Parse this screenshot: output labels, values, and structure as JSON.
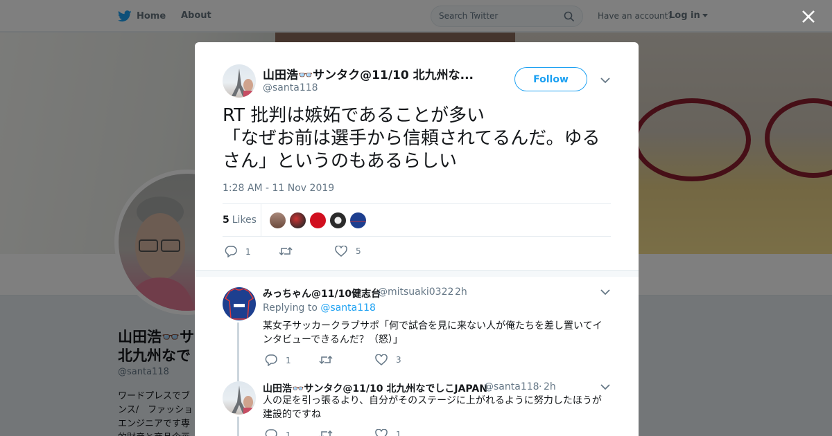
{
  "header": {
    "home_label": "Home",
    "about_label": "About",
    "search_placeholder": "Search Twitter",
    "have_account": "Have an account?",
    "login_label": "Log in"
  },
  "profile_bg": {
    "name": "山田浩👓サ\n北九州なで",
    "handle": "@santa118",
    "bio": "ワードプレスでブ\nンス/　ファッショ\nエンジニアです専\n的財産と商品企画"
  },
  "tweet": {
    "author_name": "山田浩👓サンタク@11/10 北九州な...",
    "author_handle": "@santa118",
    "follow_label": "Follow",
    "text": "RT 批判は嫉妬であることが多い\n「なぜお前は選手から信頼されてるんだ。ゆるさん」というのもあるらしい",
    "timestamp": "1:28 AM - 11 Nov 2019",
    "likes_count": "5",
    "likes_label": "Likes",
    "reply_count": "1",
    "retweet_count": "",
    "like_count": "5",
    "liker_colors": [
      "#7a5a4a",
      "#3d2a2a",
      "#d10f1f",
      "#2a2a2a",
      "#1d3f8f"
    ]
  },
  "replies": [
    {
      "name": "みっちゃん@11/10健志台",
      "handle": "@mitsuaki0322",
      "time": "2h",
      "replying_to_label": "Replying to",
      "replying_to_handle": "@santa118",
      "text": "某女子サッカークラブサポ「何で試合を見に来ない人が俺たちを差し置いてインタビューできるんだ？（怒）」",
      "reply_count": "1",
      "retweet_count": "",
      "like_count": "3"
    },
    {
      "name": "山田浩👓サンタク@11/10 北九州なでしこJAPAN",
      "handle": "@santa118",
      "time": "2h",
      "text": "人の足を引っ張るより、自分がそのステージに上がれるように努力したほうが建設的ですね",
      "reply_count": "1",
      "retweet_count": "",
      "like_count": "1"
    }
  ],
  "colors": {
    "accent": "#1da1f2",
    "muted": "#657786"
  }
}
